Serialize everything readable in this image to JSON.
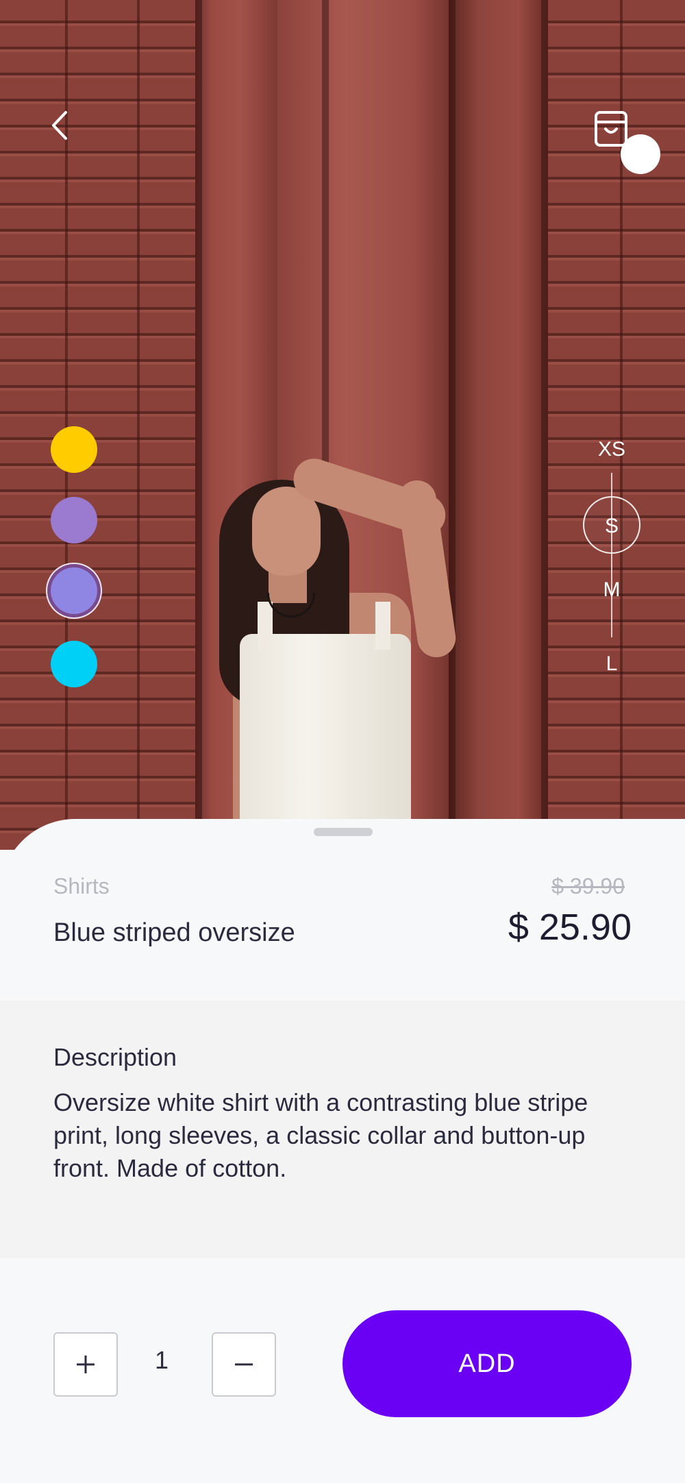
{
  "hero": {
    "back_icon": "chevron-left-icon",
    "cart_icon": "shopping-bag-icon",
    "colors": [
      {
        "name": "yellow",
        "hex": "#FFCC00",
        "selected": false
      },
      {
        "name": "lavender",
        "hex": "#9B7BD0",
        "selected": false
      },
      {
        "name": "periwinkle",
        "hex": "#8F86E3",
        "selected": true
      },
      {
        "name": "cyan",
        "hex": "#00D0F5",
        "selected": false
      }
    ],
    "sizes": [
      {
        "label": "XS",
        "selected": false
      },
      {
        "label": "S",
        "selected": true
      },
      {
        "label": "M",
        "selected": false
      },
      {
        "label": "L",
        "selected": false
      }
    ]
  },
  "product": {
    "category": "Shirts",
    "name": "Blue striped oversize",
    "old_price": "$ 39.90",
    "price": "$ 25.90"
  },
  "description": {
    "title": "Description",
    "text": "Oversize white shirt with a contrasting blue stripe print, long sleeves, a classic collar and button-up front. Made of cotton."
  },
  "footer": {
    "plus_icon": "plus-icon",
    "minus_icon": "minus-icon",
    "quantity": "1",
    "add_label": "ADD",
    "accent": "#6A00F4"
  }
}
